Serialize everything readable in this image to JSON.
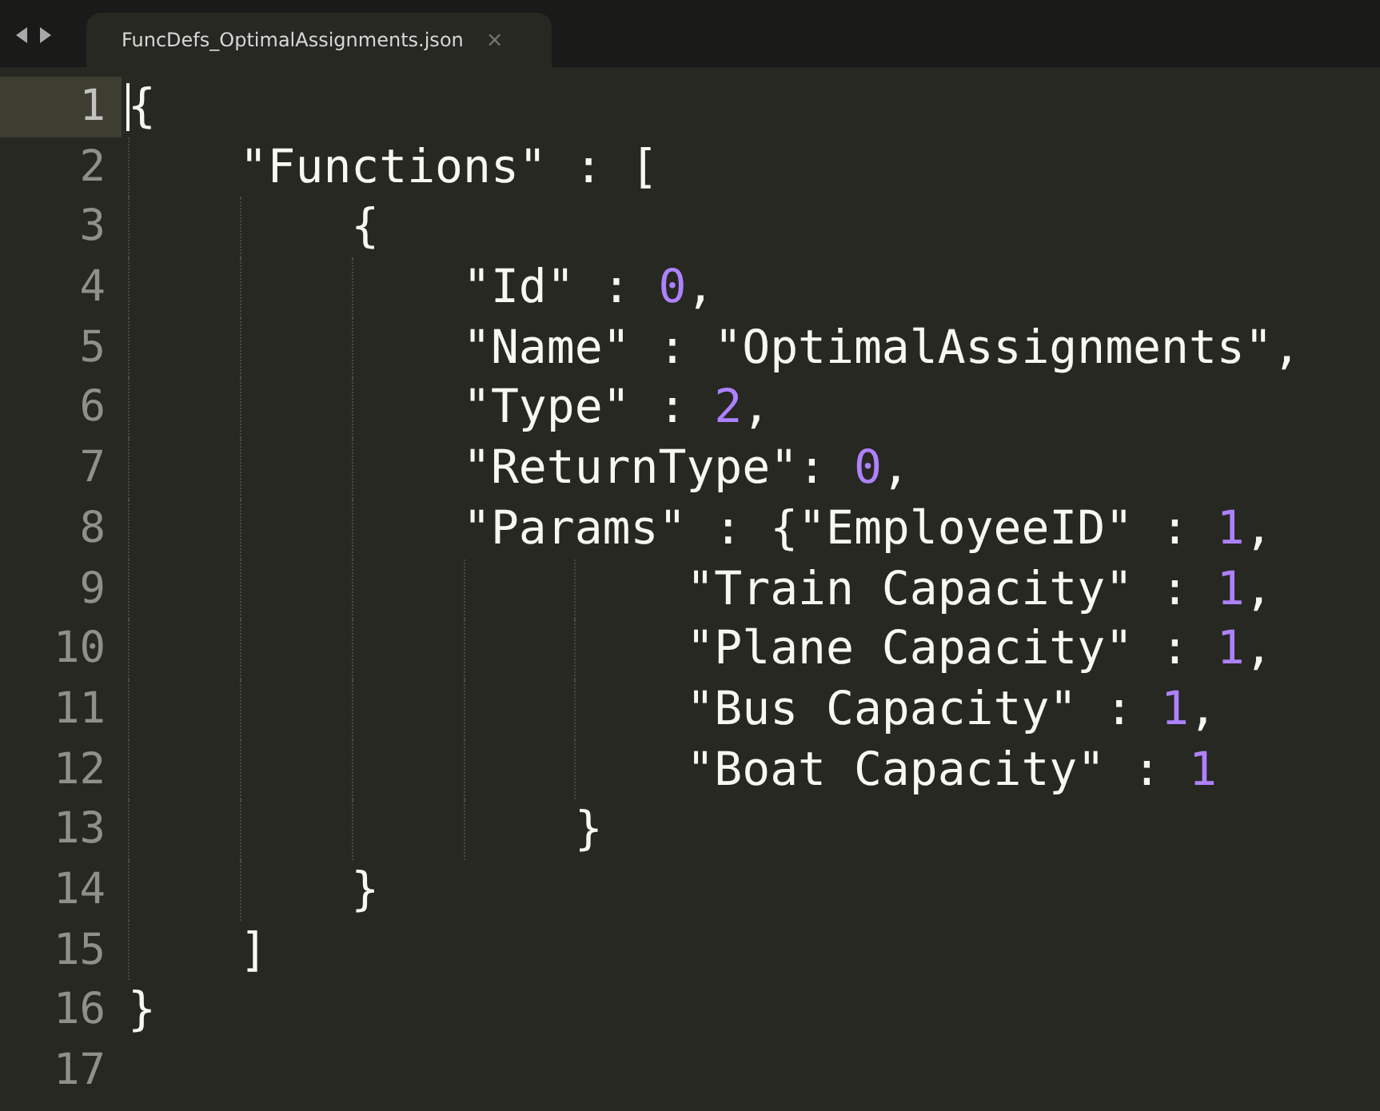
{
  "tabs": [
    {
      "label": "FuncDefs_OptimalAssignments.json",
      "close": "×",
      "selected": true
    }
  ],
  "editor": {
    "lines": [
      {
        "number": "1",
        "current": true,
        "segments": [
          {
            "kind": "text",
            "text": "{"
          }
        ]
      },
      {
        "number": "2",
        "current": false,
        "segments": [
          {
            "kind": "text",
            "text": "    \"Functions\" : ["
          }
        ]
      },
      {
        "number": "3",
        "current": false,
        "segments": [
          {
            "kind": "text",
            "text": "        {"
          }
        ]
      },
      {
        "number": "4",
        "current": false,
        "segments": [
          {
            "kind": "text",
            "text": "            \"Id\" : "
          },
          {
            "kind": "number",
            "text": "0"
          },
          {
            "kind": "text",
            "text": ","
          }
        ]
      },
      {
        "number": "5",
        "current": false,
        "segments": [
          {
            "kind": "text",
            "text": "            \"Name\" : \"OptimalAssignments\","
          }
        ]
      },
      {
        "number": "6",
        "current": false,
        "segments": [
          {
            "kind": "text",
            "text": "            \"Type\" : "
          },
          {
            "kind": "number",
            "text": "2"
          },
          {
            "kind": "text",
            "text": ","
          }
        ]
      },
      {
        "number": "7",
        "current": false,
        "segments": [
          {
            "kind": "text",
            "text": "            \"ReturnType\": "
          },
          {
            "kind": "number",
            "text": "0"
          },
          {
            "kind": "text",
            "text": ","
          }
        ]
      },
      {
        "number": "8",
        "current": false,
        "segments": [
          {
            "kind": "text",
            "text": "            \"Params\" : {\"EmployeeID\" : "
          },
          {
            "kind": "number",
            "text": "1"
          },
          {
            "kind": "text",
            "text": ","
          }
        ]
      },
      {
        "number": "9",
        "current": false,
        "segments": [
          {
            "kind": "text",
            "text": "                    \"Train Capacity\" : "
          },
          {
            "kind": "number",
            "text": "1"
          },
          {
            "kind": "text",
            "text": ","
          }
        ]
      },
      {
        "number": "10",
        "current": false,
        "segments": [
          {
            "kind": "text",
            "text": "                    \"Plane Capacity\" : "
          },
          {
            "kind": "number",
            "text": "1"
          },
          {
            "kind": "text",
            "text": ","
          }
        ]
      },
      {
        "number": "11",
        "current": false,
        "segments": [
          {
            "kind": "text",
            "text": "                    \"Bus Capacity\" : "
          },
          {
            "kind": "number",
            "text": "1"
          },
          {
            "kind": "text",
            "text": ","
          }
        ]
      },
      {
        "number": "12",
        "current": false,
        "segments": [
          {
            "kind": "text",
            "text": "                    \"Boat Capacity\" : "
          },
          {
            "kind": "number",
            "text": "1"
          }
        ]
      },
      {
        "number": "13",
        "current": false,
        "segments": [
          {
            "kind": "text",
            "text": "                }"
          }
        ]
      },
      {
        "number": "14",
        "current": false,
        "segments": [
          {
            "kind": "text",
            "text": "        }"
          }
        ]
      },
      {
        "number": "15",
        "current": false,
        "segments": [
          {
            "kind": "text",
            "text": "    ]"
          }
        ]
      },
      {
        "number": "16",
        "current": false,
        "segments": [
          {
            "kind": "text",
            "text": "}"
          }
        ]
      },
      {
        "number": "17",
        "current": false
      }
    ]
  }
}
